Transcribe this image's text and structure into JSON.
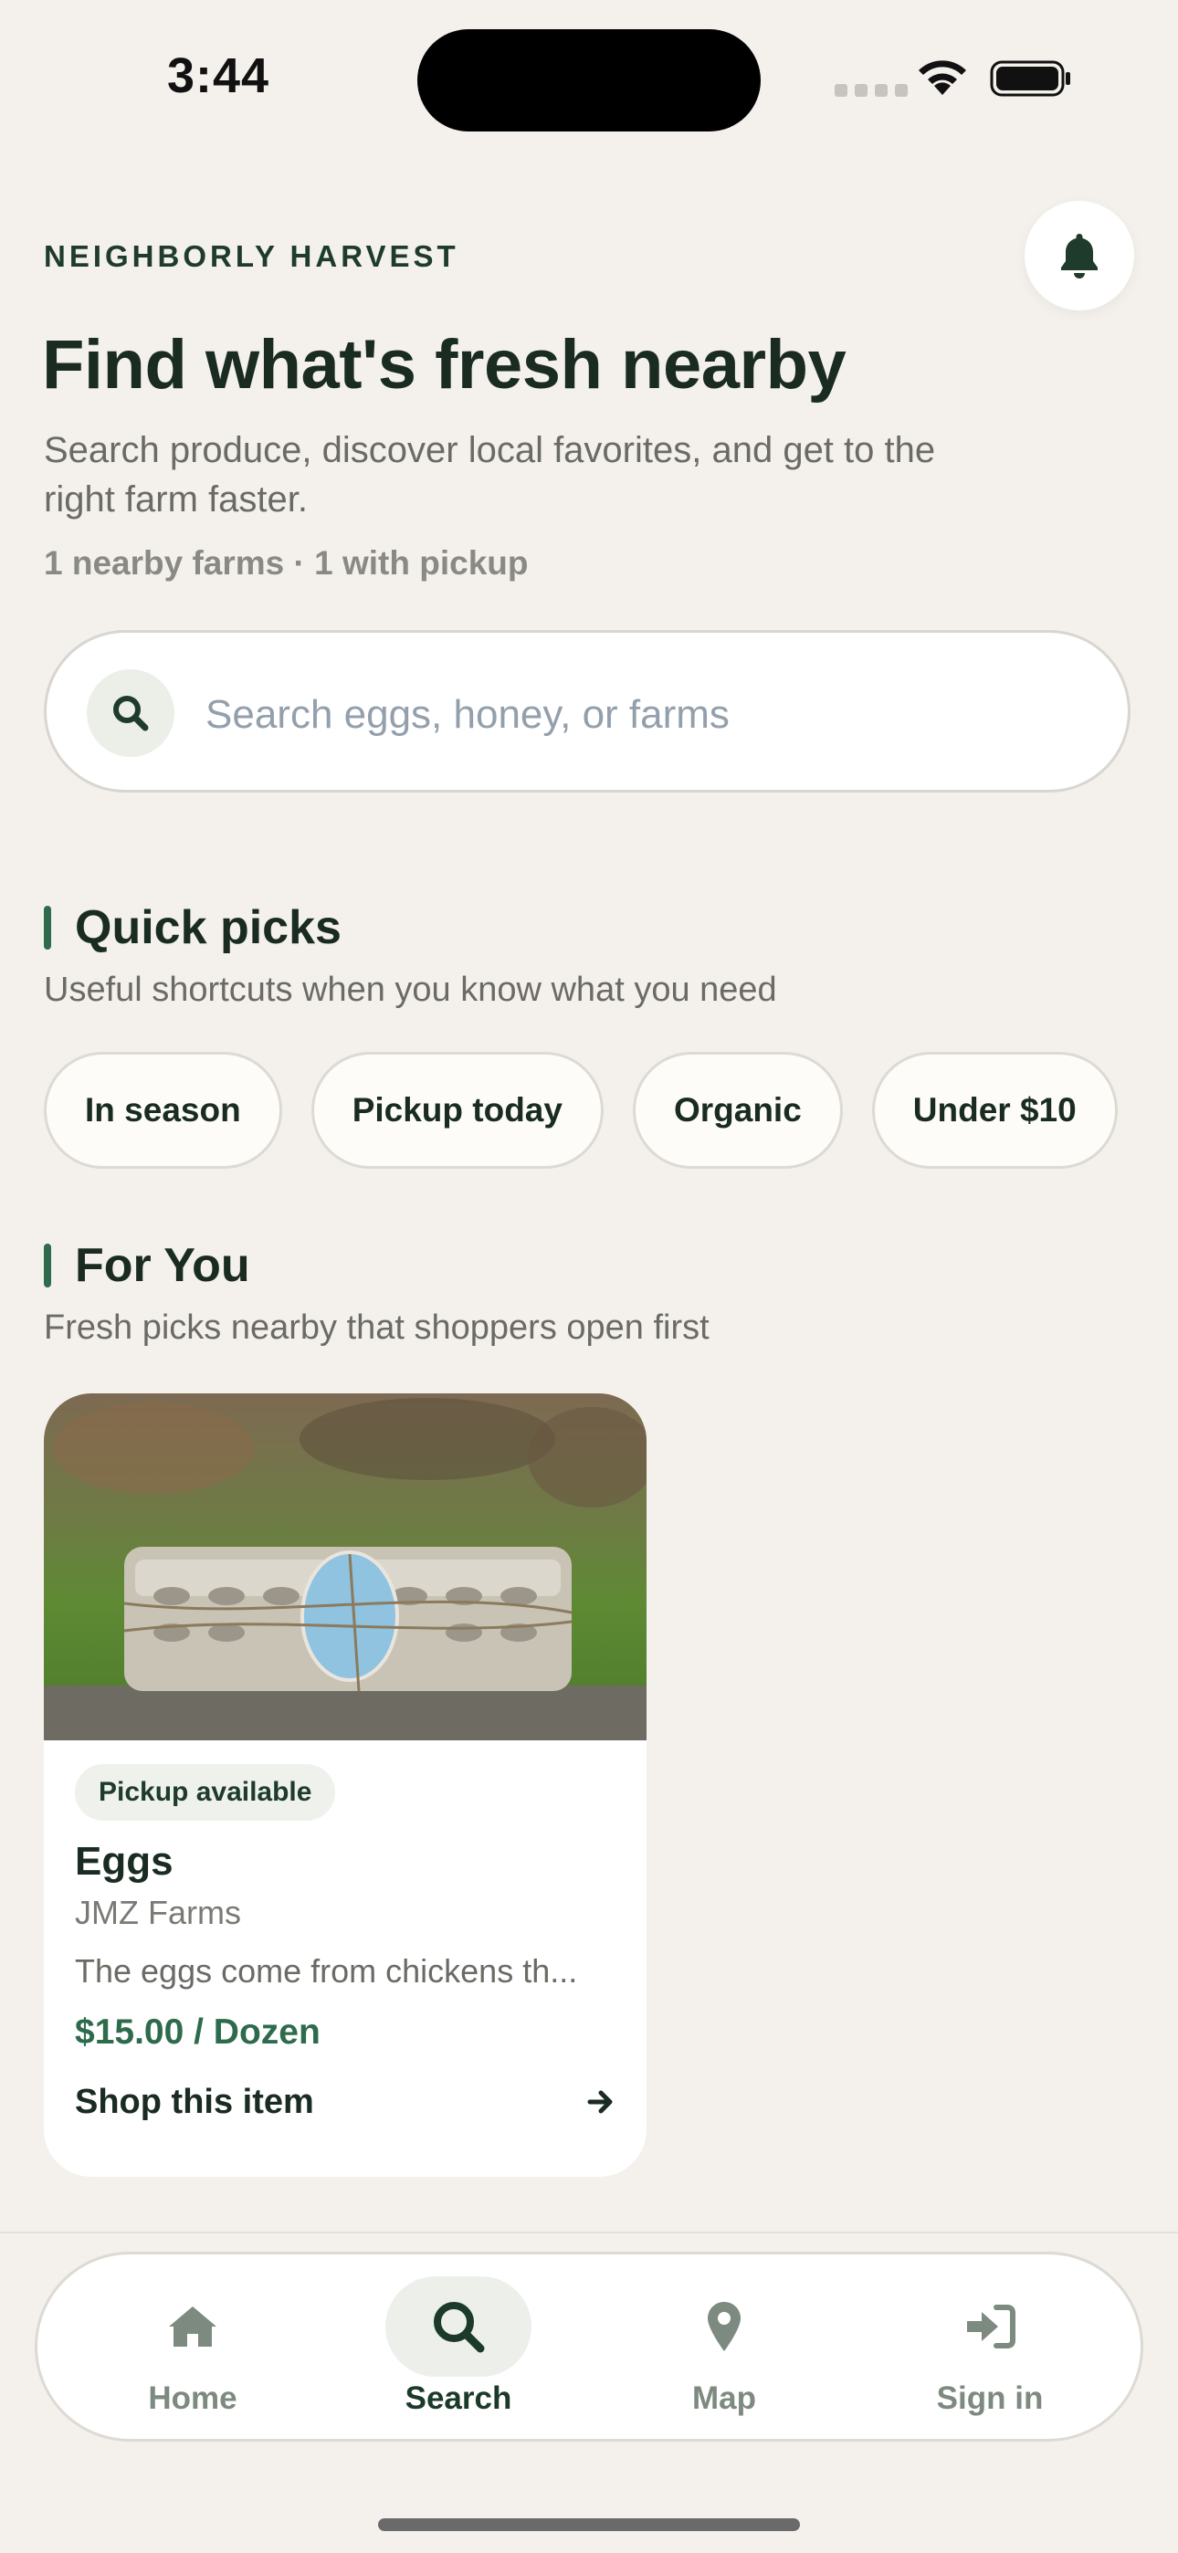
{
  "status_bar": {
    "time": "3:44"
  },
  "header": {
    "brand": "NEIGHBORLY HARVEST",
    "title": "Find what's fresh nearby",
    "subtitle": "Search produce, discover local favorites, and get to the right farm faster.",
    "meta": "1 nearby farms · 1 with pickup"
  },
  "search": {
    "placeholder": "Search eggs, honey, or farms",
    "value": ""
  },
  "quick_picks": {
    "title": "Quick picks",
    "subtitle": "Useful shortcuts when you know what you need",
    "chips": [
      "In season",
      "Pickup today",
      "Organic",
      "Under $10"
    ]
  },
  "for_you": {
    "title": "For You",
    "subtitle": "Fresh picks nearby that shoppers open first",
    "items": [
      {
        "badge": "Pickup available",
        "name": "Eggs",
        "farm": "JMZ Farms",
        "description": "The eggs come from chickens th...",
        "price": "$15.00 / Dozen",
        "cta": "Shop this item"
      }
    ]
  },
  "tab_bar": {
    "tabs": [
      {
        "label": "Home",
        "icon": "home-icon",
        "active": false
      },
      {
        "label": "Search",
        "icon": "search-icon",
        "active": true
      },
      {
        "label": "Map",
        "icon": "map-pin-icon",
        "active": false
      },
      {
        "label": "Sign in",
        "icon": "sign-in-icon",
        "active": false
      }
    ]
  },
  "colors": {
    "background": "#f4f1ec",
    "accent_green": "#2e6b4c",
    "dark_text": "#1a2c22",
    "muted_text": "#6b6b66",
    "surface": "#ffffff"
  }
}
